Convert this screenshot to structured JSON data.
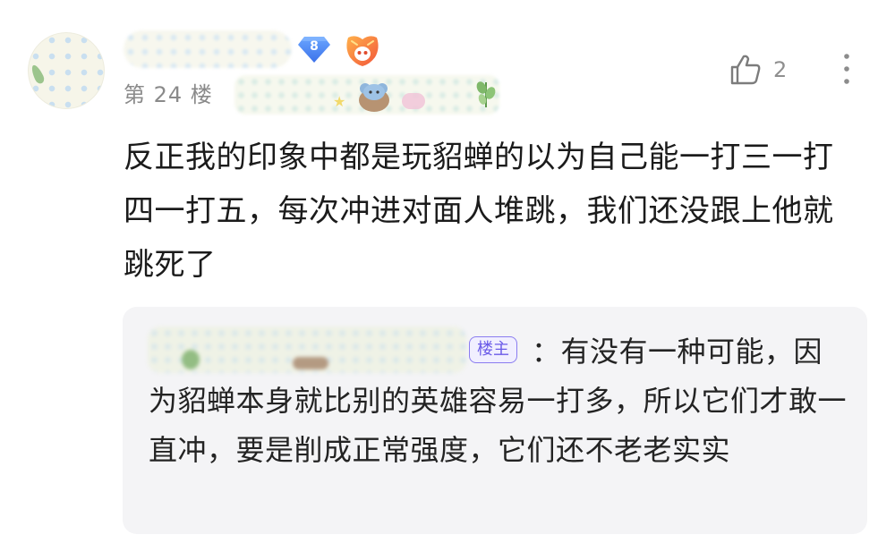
{
  "post": {
    "user": {
      "level": "8"
    },
    "floor_label": "第 24 楼",
    "likes": {
      "count": "2"
    },
    "content": "反正我的印象中都是玩貂蝉的以为自己能一打三一打四一打五，每次冲进对面人堆跳，我们还没跟上他就跳死了",
    "reply": {
      "op_badge": "楼主",
      "separator": "：",
      "text": "有没有一种可能，因为貂蝉本身就比别的英雄容易一打多，所以它们才敢一直冲，要是削成正常强度，它们还不老老实实"
    }
  },
  "icons": {
    "like": "thumbs-up-icon",
    "more": "more-vertical-icon",
    "level": "diamond-level-icon",
    "game": "game-emblem-icon"
  },
  "colors": {
    "accent_op": "#6a5ae8",
    "level_badge": "#4f8df5",
    "muted_text": "#8a8a8a",
    "reply_bg": "#f4f4f6"
  }
}
